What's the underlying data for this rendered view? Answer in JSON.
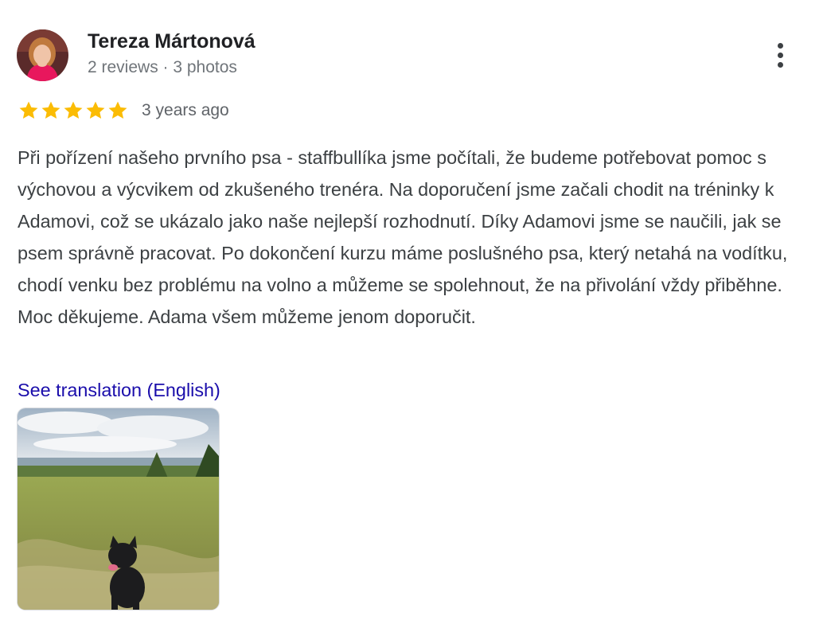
{
  "review": {
    "author": {
      "name": "Tereza Mártonová",
      "meta": "2 reviews · 3 photos",
      "avatar_icon": "user-avatar-photo"
    },
    "more_icon": "more-vert-icon",
    "rating": {
      "stars": 5,
      "max_stars": 5,
      "star_color": "#fbbc04",
      "date": "3 years ago"
    },
    "text": "Při pořízení našeho prvního psa - staffbullíka jsme počítali, že budeme potřebovat pomoc s výchovou a výcvikem od zkušeného trenéra. Na doporučení jsme začali chodit na tréninky k Adamovi, což se ukázalo jako naše nejlepší rozhodnutí. Díky Adamovi jsme se naučili, jak se psem správně pracovat. Po dokončení kurzu máme poslušného psa, který netahá na vodítku, chodí venku bez problému na volno a můžeme se spolehnout, že na přivolání vždy přiběhne. Moc děkujeme. Adama všem můžeme jenom doporučit.",
    "translate_link": "See translation (English)",
    "link_color": "#1a0dab",
    "photos": [
      {
        "icon": "review-photo-dog-in-meadow"
      }
    ]
  }
}
